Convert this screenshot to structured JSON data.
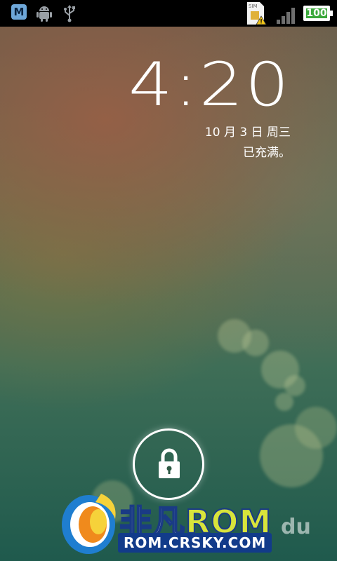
{
  "status_bar": {
    "notification_icons": [
      "launcher-m-icon",
      "android-debug-icon",
      "usb-icon"
    ],
    "m_icon_letter": "M",
    "sim_icon": "sim-warning-icon",
    "signal_icon": "signal-bars-icon",
    "battery_level": "100"
  },
  "lockscreen": {
    "time": "4:20",
    "date": "10 月 3 日 周三",
    "charging_status": "已充满。",
    "unlock_icon": "lock-icon"
  },
  "watermark": {
    "brand_cn": "非凡",
    "brand_rom": "ROM",
    "url": "ROM.CRSKY.COM",
    "extra": "du"
  },
  "colors": {
    "statusbar_bg": "#000000",
    "battery_fill": "#3aa83a",
    "watermark_blue": "#123b8a",
    "watermark_yellow": "#d8e43b"
  }
}
